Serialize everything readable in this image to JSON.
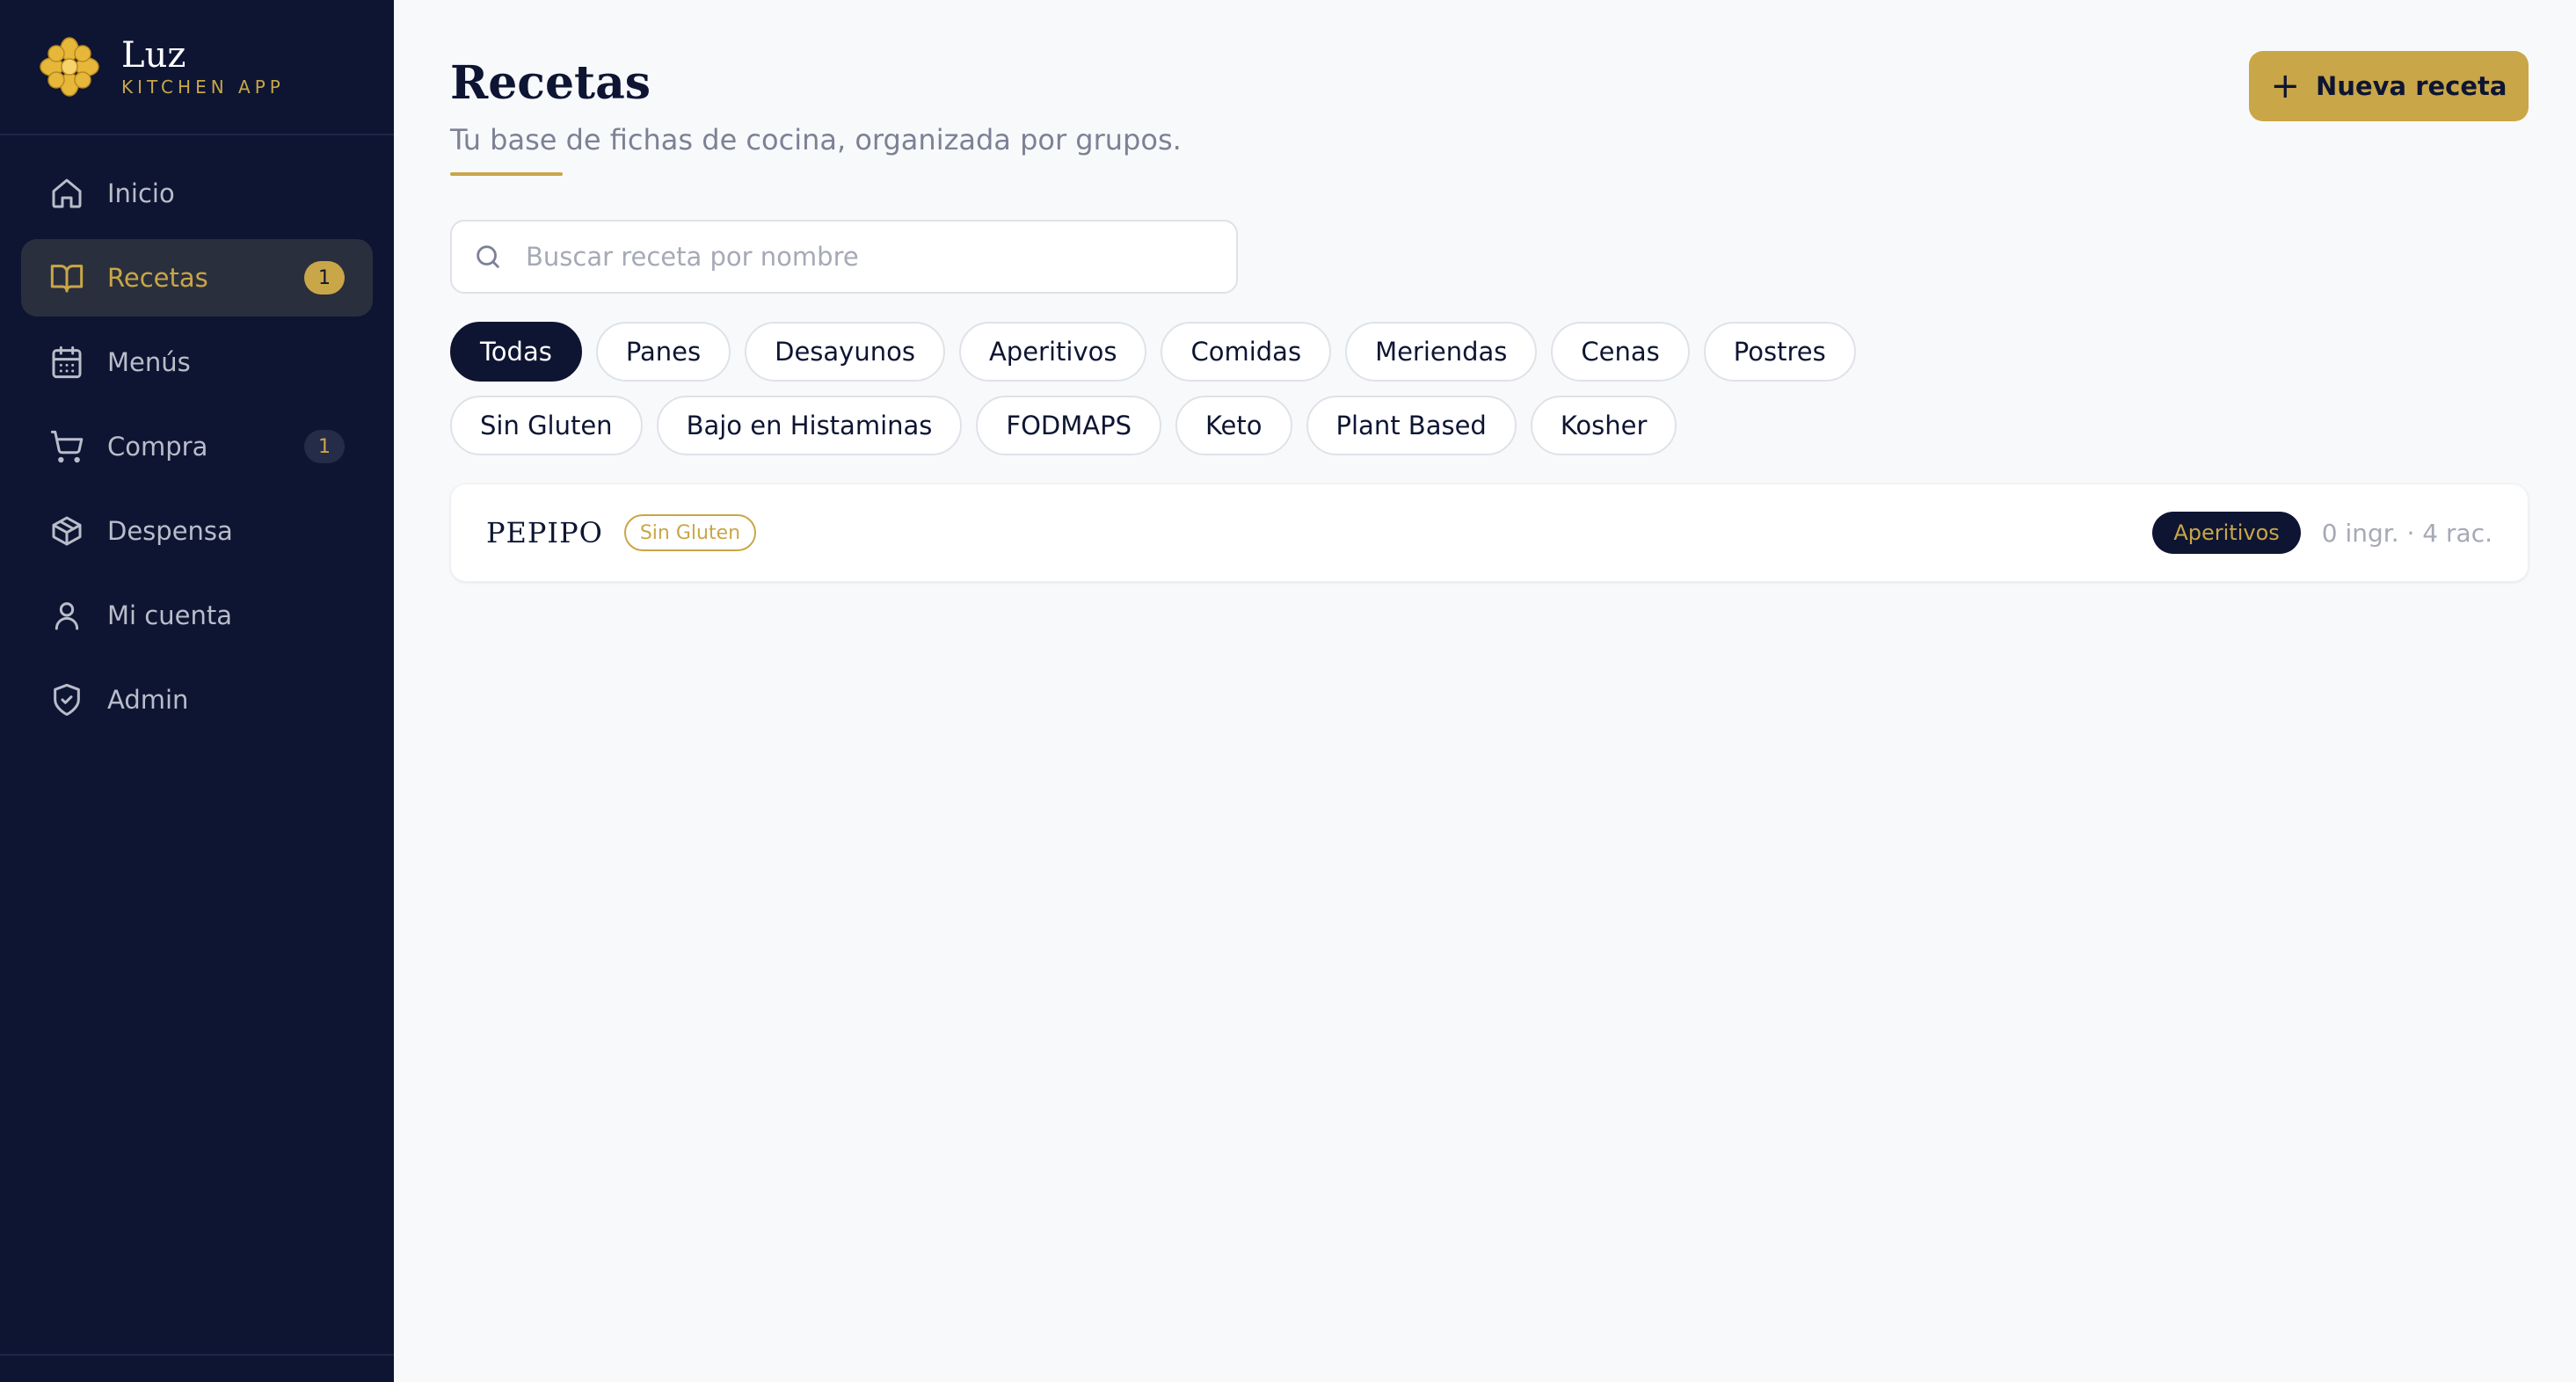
{
  "brand": {
    "name": "Luz",
    "subtitle": "KITCHEN APP",
    "logo_icon": "gold-flower-icon",
    "accent_color": "#c9a647",
    "sidebar_color": "#0e1533"
  },
  "nav": {
    "items": [
      {
        "key": "inicio",
        "label": "Inicio",
        "icon": "home-icon",
        "active": false,
        "badge": ""
      },
      {
        "key": "recetas",
        "label": "Recetas",
        "icon": "book-open-icon",
        "active": true,
        "badge": "1"
      },
      {
        "key": "menus",
        "label": "Menús",
        "icon": "calendar-icon",
        "active": false,
        "badge": ""
      },
      {
        "key": "compra",
        "label": "Compra",
        "icon": "cart-icon",
        "active": false,
        "badge": "1"
      },
      {
        "key": "despensa",
        "label": "Despensa",
        "icon": "box-icon",
        "active": false,
        "badge": ""
      },
      {
        "key": "mi-cuenta",
        "label": "Mi cuenta",
        "icon": "user-icon",
        "active": false,
        "badge": ""
      },
      {
        "key": "admin",
        "label": "Admin",
        "icon": "shield-check-icon",
        "active": false,
        "badge": ""
      }
    ]
  },
  "header": {
    "title": "Recetas",
    "subtitle": "Tu base de fichas de cocina, organizada por grupos.",
    "new_button_label": "Nueva receta"
  },
  "search": {
    "placeholder": "Buscar receta por nombre",
    "value": ""
  },
  "filters": {
    "row1": [
      "Todas",
      "Panes",
      "Desayunos",
      "Aperitivos",
      "Comidas",
      "Meriendas",
      "Cenas",
      "Postres"
    ],
    "row2": [
      "Sin Gluten",
      "Bajo en Histaminas",
      "FODMAPS",
      "Keto",
      "Plant Based",
      "Kosher"
    ],
    "active": "Todas"
  },
  "recipes": [
    {
      "name": "PEPIPO",
      "diet_tag": "Sin Gluten",
      "group_tag": "Aperitivos",
      "meta": "0 ingr. · 4 rac."
    }
  ]
}
